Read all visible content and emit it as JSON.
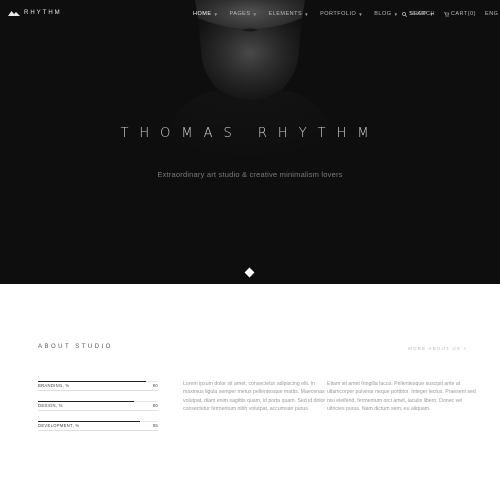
{
  "brand": {
    "name": "RHYTHM"
  },
  "nav": {
    "items": [
      {
        "label": "HOME",
        "active": true
      },
      {
        "label": "PAGES",
        "active": false
      },
      {
        "label": "ELEMENTS",
        "active": false
      },
      {
        "label": "PORTFOLIO",
        "active": false
      },
      {
        "label": "BLOG",
        "active": false
      },
      {
        "label": "SHOP",
        "active": false
      }
    ],
    "search": "SEARCH",
    "cart": "CART(0)",
    "language": "ENG"
  },
  "hero": {
    "title": "THOMAS RHYTHM",
    "subtitle": "Extraordinary art studio & creative minimalism lovers"
  },
  "about": {
    "title": "ABOUT STUDIO",
    "more_link": "MORE ABOUT US >",
    "skills": [
      {
        "label": "BRANDING, %",
        "value": "90",
        "fraction": 0.9
      },
      {
        "label": "DESIGN, %",
        "value": "80",
        "fraction": 0.8
      },
      {
        "label": "DEVELOPMENT, %",
        "value": "85",
        "fraction": 0.85
      }
    ],
    "paragraph_1": "Lorem ipsum dolor sit amet, consectetur adipiscing elit. In maximus ligula semper metus pellentesque mattis. Maecenas volutpat, diam enim sagittis quam, id porta quam. Sed id dolor consectetur fermentum nibh volutpat, accumsan purus.",
    "paragraph_2": "Etiam sit amet fringilla lacus. Pellentesque suscipit ante at ullamcorper pulvinar neque porttitor. Integer lectus. Praesent sed nisi eleifend, fermentum orci amet, iaculis libero. Donec vel ultricies purus. Nam dictum sem, eu aliquam."
  },
  "colors": {
    "hero_bg": "#0e0e0e",
    "accent": "#ffffff"
  }
}
